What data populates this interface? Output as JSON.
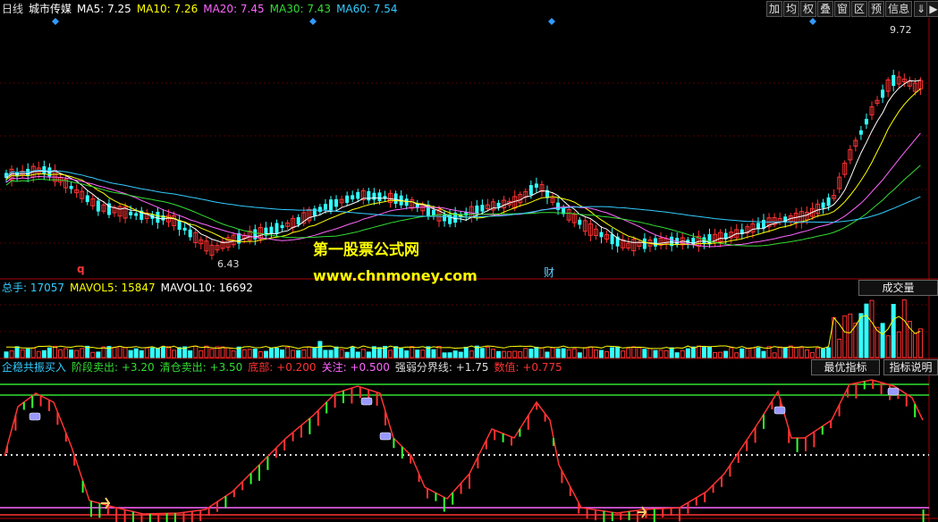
{
  "header": {
    "period": "日线",
    "stock_name": "城市传媒",
    "ma": [
      {
        "label": "MA5:",
        "value": "7.25",
        "color": "#ffffff"
      },
      {
        "label": "MA10:",
        "value": "7.26",
        "color": "#ffff00"
      },
      {
        "label": "MA20:",
        "value": "7.45",
        "color": "#ff66ff"
      },
      {
        "label": "MA30:",
        "value": "7.43",
        "color": "#33dd33"
      },
      {
        "label": "MA60:",
        "value": "7.54",
        "color": "#33ccff"
      }
    ]
  },
  "toolbar": {
    "buttons": [
      "加",
      "均",
      "权",
      "叠",
      "窗",
      "区",
      "预",
      "信息"
    ],
    "arrow": "⇓",
    "arrow2": "▶"
  },
  "price_chart": {
    "high_label": "9.72",
    "low_label": "6.43",
    "marker_q": "q",
    "marker_cai": "财"
  },
  "volume_panel": {
    "items": [
      {
        "label": "总手:",
        "value": "17057",
        "color": "#33ccff"
      },
      {
        "label": "MAVOL5:",
        "value": "15847",
        "color": "#ffff00"
      },
      {
        "label": "MAVOL10:",
        "value": "16692",
        "color": "#ffffff"
      }
    ],
    "dropdown": "成交量"
  },
  "indicator_panel": {
    "name": "企稳共振买入",
    "items": [
      {
        "label": "阶段卖出:",
        "value": "+3.20",
        "color": "#33dd33"
      },
      {
        "label": "清仓卖出:",
        "value": "+3.50",
        "color": "#33dd33"
      },
      {
        "label": "底部:",
        "value": "+0.200",
        "color": "#ff3333"
      },
      {
        "label": "关注:",
        "value": "+0.500",
        "color": "#ff66ff"
      },
      {
        "label": "强弱分界线:",
        "value": "+1.75",
        "color": "#dddddd"
      },
      {
        "label": "数值:",
        "value": "+0.775",
        "color": "#ff3333"
      }
    ],
    "btn_best": "最优指标",
    "btn_help": "指标说明"
  },
  "watermark": {
    "line1": "第一股票公式网",
    "line2": "www.chnmoney.com"
  }
}
